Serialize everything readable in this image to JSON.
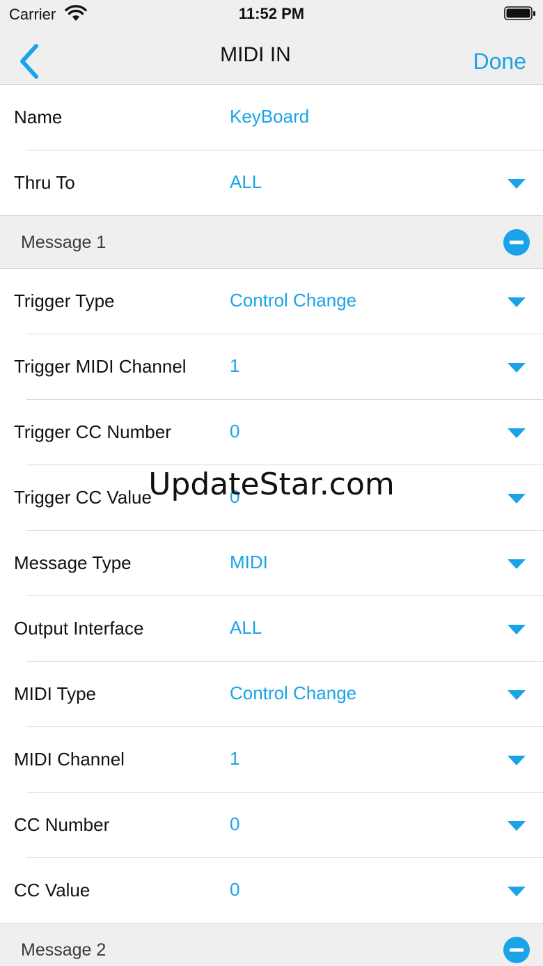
{
  "status_bar": {
    "carrier": "Carrier",
    "time": "11:52 PM",
    "wifi_icon": "wifi-icon",
    "battery_icon": "battery-icon"
  },
  "nav": {
    "back_icon": "chevron-left-icon",
    "title": "MIDI IN",
    "done_label": "Done"
  },
  "colors": {
    "accent": "#1aa3e8",
    "section_bg": "#efefef",
    "bar_bg": "#efefef"
  },
  "fields": {
    "name": {
      "label": "Name",
      "value": "KeyBoard"
    },
    "thru_to": {
      "label": "Thru To",
      "value": "ALL"
    }
  },
  "message1": {
    "header": "Message 1",
    "rows": [
      {
        "label": "Trigger Type",
        "value": "Control Change"
      },
      {
        "label": "Trigger MIDI Channel",
        "value": "1"
      },
      {
        "label": "Trigger CC Number",
        "value": "0"
      },
      {
        "label": "Trigger CC Value",
        "value": "0"
      },
      {
        "label": "Message Type",
        "value": "MIDI"
      },
      {
        "label": "Output Interface",
        "value": "ALL"
      },
      {
        "label": "MIDI Type",
        "value": "Control Change"
      },
      {
        "label": "MIDI Channel",
        "value": "1"
      },
      {
        "label": "CC Number",
        "value": "0"
      },
      {
        "label": "CC Value",
        "value": "0"
      }
    ]
  },
  "message2": {
    "header": "Message 2"
  },
  "watermark": "UpdateStar.com"
}
